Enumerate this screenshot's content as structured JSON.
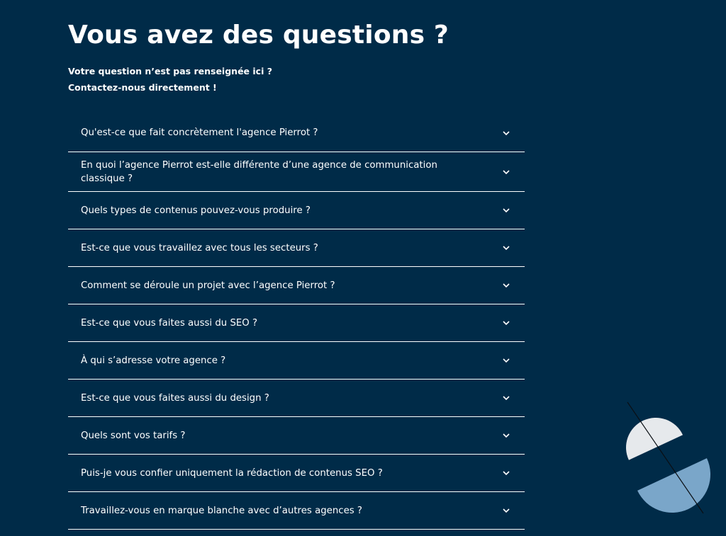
{
  "heading": "Vous avez des questions ?",
  "intro": {
    "line1": "Votre question n’est pas renseignée ici ?",
    "line2": "Contactez-nous directement !"
  },
  "faq": {
    "items": [
      {
        "question": "Qu'est-ce que fait concrètement l'agence Pierrot ?"
      },
      {
        "question": "En quoi l’agence Pierrot est-elle différente d’une agence de communication classique ?"
      },
      {
        "question": "Quels types de contenus pouvez-vous produire ?"
      },
      {
        "question": "Est-ce que vous travaillez avec tous les secteurs ?"
      },
      {
        "question": "Comment se déroule un projet avec l’agence Pierrot ?"
      },
      {
        "question": "Est-ce que vous faites aussi du SEO ?"
      },
      {
        "question": "À qui s’adresse votre agence ?"
      },
      {
        "question": "Est-ce que vous faites aussi du design ?"
      },
      {
        "question": "Quels sont vos tarifs ?"
      },
      {
        "question": "Puis-je vous confier uniquement la rédaction de contenus SEO ?"
      },
      {
        "question": "Travaillez-vous en marque blanche avec d’autres agences ?"
      }
    ],
    "expand_icon": "chevron-down-icon"
  },
  "colors": {
    "background": "#002b48",
    "text": "#ffffff",
    "decor_light": "#e6e9ec",
    "decor_blue": "#7aa6c9"
  }
}
